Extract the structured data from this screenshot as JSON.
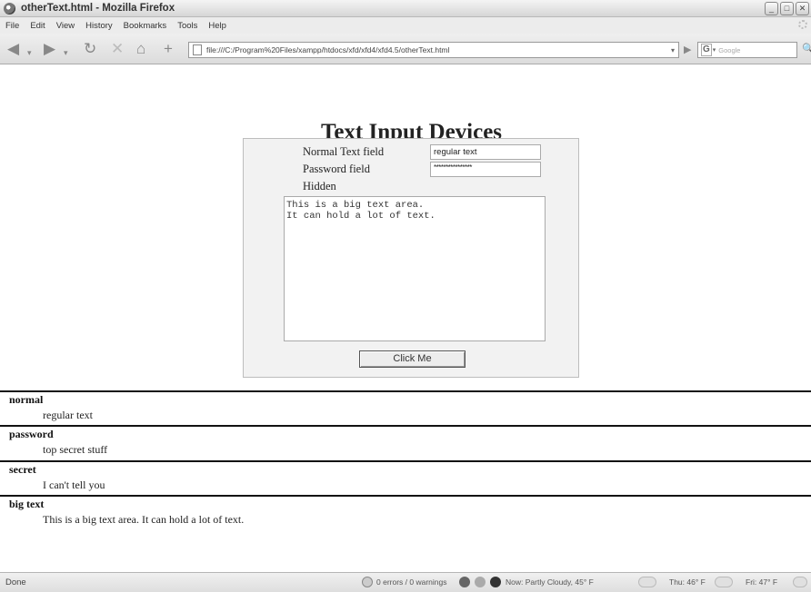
{
  "window": {
    "title": "otherText.html - Mozilla Firefox",
    "minimize_label": "_",
    "maximize_label": "□",
    "close_label": "✕"
  },
  "menu": {
    "items": [
      "File",
      "Edit",
      "View",
      "History",
      "Bookmarks",
      "Tools",
      "Help"
    ]
  },
  "navbar": {
    "url": "file:///C:/Program%20Files/xampp/htdocs/xfd/xfd4/xfd4.5/otherText.html",
    "search_placeholder": "Google",
    "search_engine_label": "G",
    "icons": {
      "back": "◀",
      "forward": "▶",
      "reload": "↻",
      "stop": "✕",
      "home": "⌂",
      "new_tab": "+",
      "go": "▶",
      "search": "🔍",
      "dropdown": "▾"
    }
  },
  "page": {
    "heading": "Text Input Devices",
    "form": {
      "normal_label": "Normal Text field",
      "normal_value": "regular text",
      "password_label": "Password field",
      "password_value": "****************",
      "hidden_label": "Hidden",
      "textarea_value": "This is a big text area.\nIt can hold a lot of text.",
      "button_label": "Click Me"
    },
    "results": [
      {
        "label": "normal",
        "value": "regular text"
      },
      {
        "label": "password",
        "value": "top secret stuff"
      },
      {
        "label": "secret",
        "value": "I can't tell you"
      },
      {
        "label": "big text",
        "value": "This is a big text area.  It can hold a lot of text."
      }
    ]
  },
  "status": {
    "text": "Done",
    "errors": "0 errors / 0 warnings",
    "weather_now": "Now: Partly Cloudy, 45° F",
    "weather_thu": "Thu: 46° F",
    "weather_fri": "Fri: 47° F"
  },
  "colors": {
    "form_bg": "#f2f2f2",
    "rule": "#111111"
  }
}
